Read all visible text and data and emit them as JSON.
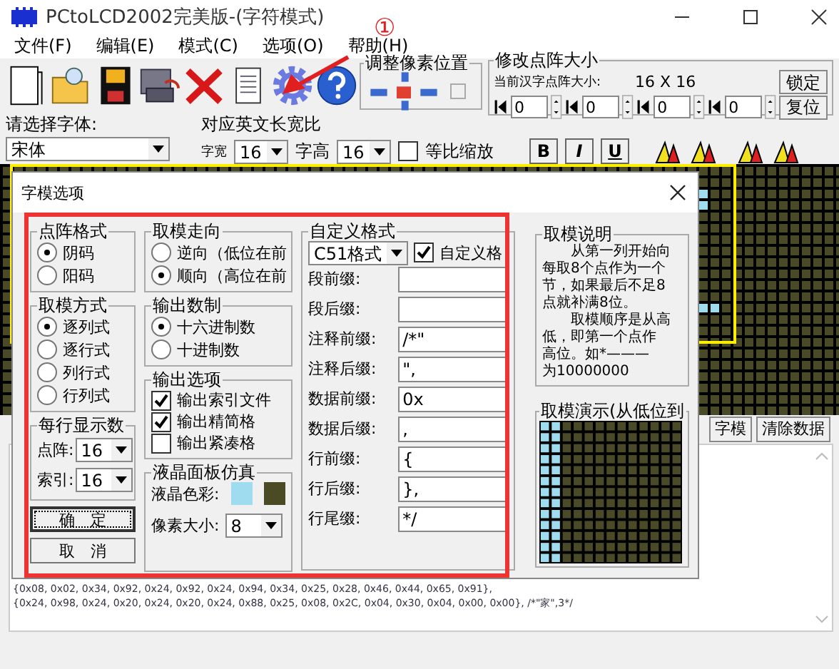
{
  "window": {
    "title": "PCtoLCD2002完美版-(字符模式)"
  },
  "menu": [
    "文件(F)",
    "编辑(E)",
    "模式(C)",
    "选项(O)",
    "帮助(H)"
  ],
  "annotation": {
    "marker": "①"
  },
  "pixel_position": {
    "title": "调整像素位置"
  },
  "matrix_size": {
    "title": "修改点阵大小",
    "current_label": "当前汉字点阵大小:",
    "current_value": "16 X 16",
    "lock_button": "锁定",
    "reset_button": "复位",
    "spinners": [
      {
        "value": "0"
      },
      {
        "value": "0"
      },
      {
        "value": "0"
      },
      {
        "value": "0"
      }
    ]
  },
  "font": {
    "label": "请选择字体:",
    "value": "宋体",
    "ratio_label": "对应英文长宽比",
    "width_label": "字宽",
    "width_value": "16",
    "height_label": "字高",
    "height_value": "16",
    "proportional": {
      "label": "等比缩放",
      "checked": false
    },
    "style_buttons": [
      "B",
      "I",
      "U"
    ]
  },
  "main": {
    "buttons": [
      "字模",
      "清除数据"
    ],
    "output_lines": [
      "{0x08, 0x02, 0x34, 0x92, 0x24, 0x92, 0x24, 0x94, 0x34, 0x25, 0x28, 0x46, 0x44, 0x65, 0x91},",
      "{0x24, 0x98, 0x24, 0x20, 0x24, 0x20, 0x24, 0x88, 0x25, 0x08, 0x2C, 0x04, 0x30, 0x04, 0x00, 0x00}, /*\"家\",3*/"
    ]
  },
  "dialog": {
    "title": "字模选项",
    "dot_format": {
      "title": "点阵格式",
      "options": [
        {
          "label": "阴码",
          "selected": true
        },
        {
          "label": "阳码",
          "selected": false
        }
      ]
    },
    "scan_mode": {
      "title": "取模方式",
      "options": [
        {
          "label": "逐列式",
          "selected": true
        },
        {
          "label": "逐行式",
          "selected": false
        },
        {
          "label": "列行式",
          "selected": false
        },
        {
          "label": "行列式",
          "selected": false
        }
      ]
    },
    "per_line": {
      "title": "每行显示数",
      "fields": [
        {
          "label": "点阵:",
          "value": "16"
        },
        {
          "label": "索引:",
          "value": "16"
        }
      ]
    },
    "buttons": [
      {
        "label": "确　定",
        "focused": true
      },
      {
        "label": "取　消",
        "focused": false
      }
    ],
    "direction": {
      "title": "取模走向",
      "options": [
        {
          "label": "逆向（低位在前",
          "selected": false
        },
        {
          "label": "顺向（高位在前",
          "selected": true
        }
      ]
    },
    "number_base": {
      "title": "输出数制",
      "options": [
        {
          "label": "十六进制数",
          "selected": true
        },
        {
          "label": "十进制数",
          "selected": false
        }
      ]
    },
    "output_options": {
      "title": "输出选项",
      "options": [
        {
          "label": "输出索引文件",
          "checked": true
        },
        {
          "label": "输出精简格",
          "checked": true
        },
        {
          "label": "输出紧凑格",
          "checked": false
        }
      ]
    },
    "lcd": {
      "title": "液晶面板仿真",
      "color_label": "液晶色彩:",
      "colors": [
        {
          "color": "#9fdcef"
        },
        {
          "color": "#4a4a24"
        }
      ],
      "pixel_label": "像素大小:",
      "pixel_value": "8"
    },
    "custom": {
      "title": "自定义格式",
      "preset": "C51格式",
      "enabled": {
        "label": "自定义格",
        "checked": true
      },
      "fields": [
        {
          "label": "段前缀:"
        },
        {
          "label": "段后缀:"
        },
        {
          "label": "注释前缀:",
          "value": "/*\""
        },
        {
          "label": "注释后缀:",
          "value": "\","
        },
        {
          "label": "数据前缀:",
          "value": "0x"
        },
        {
          "label": "数据后缀:",
          "value": ","
        },
        {
          "label": "行前缀:",
          "value": "{"
        },
        {
          "label": "行后缀:",
          "value": "},"
        },
        {
          "label": "行尾缀:",
          "value": "*/"
        }
      ]
    },
    "explain": {
      "title": "取模说明",
      "lines": [
        "从第一列开始向",
        "每取8个点作为一个",
        "节，如果最后不足8",
        "点就补满8位。",
        "取模顺序是从高",
        "低，即第一个点作",
        "高位。如*———",
        "为10000000"
      ]
    },
    "demo": {
      "title": "取模演示(从低位到"
    }
  }
}
